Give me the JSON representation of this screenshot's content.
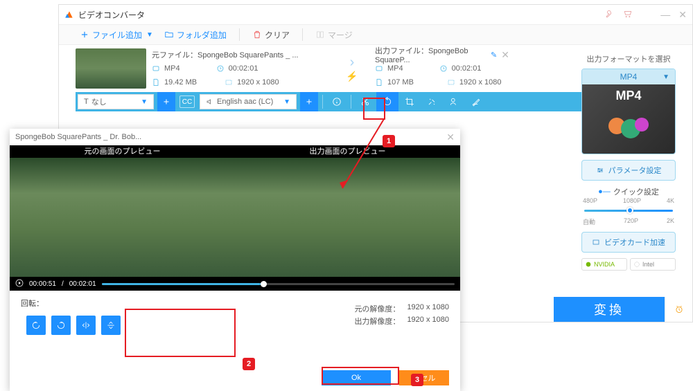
{
  "window": {
    "title": "ビデオコンバータ"
  },
  "toolbar": {
    "add_file": "ファイル追加",
    "add_folder": "フォルダ追加",
    "clear": "クリア",
    "merge": "マージ"
  },
  "source": {
    "label": "元ファイル：",
    "filename": "SpongeBob SquarePants _ ...",
    "format": "MP4",
    "duration": "00:02:01",
    "size": "19.42 MB",
    "resolution": "1920 x 1080"
  },
  "output": {
    "label": "出力ファイル：",
    "filename": "SpongeBob SquareP...",
    "format": "MP4",
    "duration": "00:02:01",
    "size": "107 MB",
    "resolution": "1920 x 1080"
  },
  "editbar": {
    "subtitle": "なし",
    "audio": "English aac (LC)"
  },
  "sidebar": {
    "heading": "出力フォーマットを選択",
    "format": "MP4",
    "format_label": "MP4",
    "parameter_btn": "パラメータ設定",
    "quick_title": "クイック設定",
    "slider": {
      "l0": "480P",
      "l1": "1080P",
      "l2": "4K",
      "m0": "自動",
      "m1": "720P",
      "m2": "2K"
    },
    "gpu_btn": "ビデオカード加速",
    "nvidia": "NVIDIA",
    "intel": "Intel"
  },
  "convert_btn": "変換",
  "dialog": {
    "title": "SpongeBob SquarePants _ Dr. Bob...",
    "preview_src": "元の画面のプレビュー",
    "preview_out": "出力画面のプレビュー",
    "time_current": "00:00:51",
    "time_total": "00:02:01",
    "rotate_label": "回転：",
    "res_src_label": "元の解像度：",
    "res_src": "1920 x 1080",
    "res_out_label": "出力解像度：",
    "res_out": "1920 x 1080",
    "ok": "Ok",
    "cancel": "ンセル"
  },
  "callouts": {
    "c1": "1",
    "c2": "2",
    "c3": "3"
  }
}
